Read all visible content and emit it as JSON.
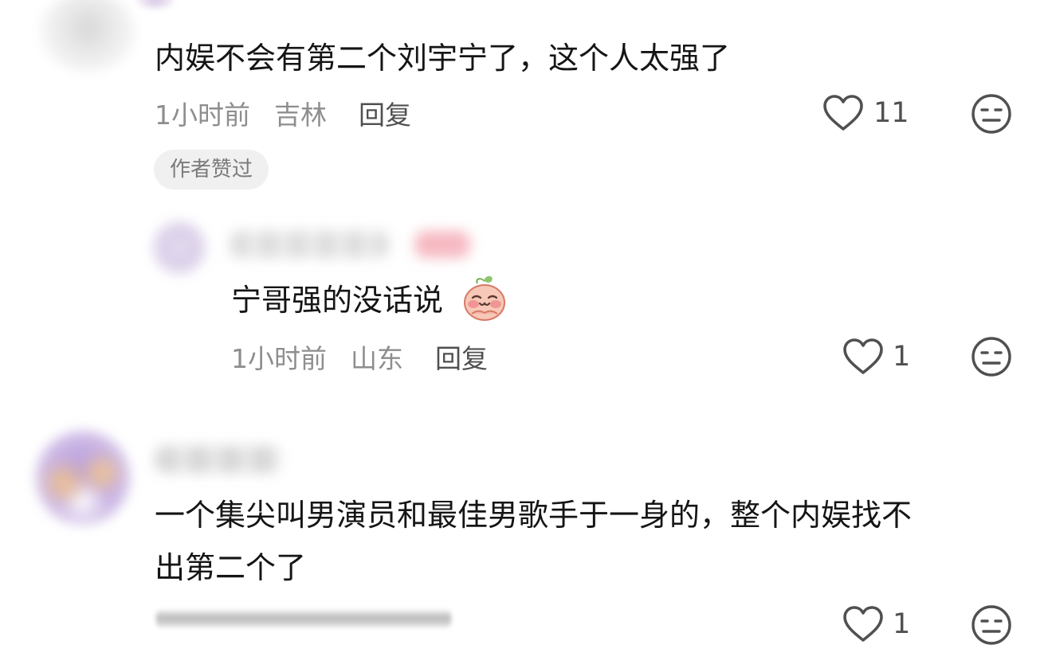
{
  "comments": [
    {
      "text": "内娱不会有第二个刘宇宁了，这个人太强了",
      "time": "1小时前",
      "location": "吉林",
      "reply_label": "回复",
      "likes": "11",
      "badge": "作者赞过"
    },
    {
      "text": "宁哥强的没话说",
      "emoji": "blushing-peach-emoji",
      "time": "1小时前",
      "location": "山东",
      "reply_label": "回复",
      "likes": "1"
    },
    {
      "text_line1": "一个集尖叫男演员和最佳男歌手于一身的，整个内娱找不",
      "text_line2": "出第二个了",
      "likes": "1"
    }
  ],
  "icons": {
    "like": "heart-outline-icon",
    "dislike": "unamused-face-icon"
  },
  "colors": {
    "text": "#151515",
    "meta": "#8e8e8e",
    "icon": "#505050",
    "badge_bg": "#f0f0f0"
  }
}
